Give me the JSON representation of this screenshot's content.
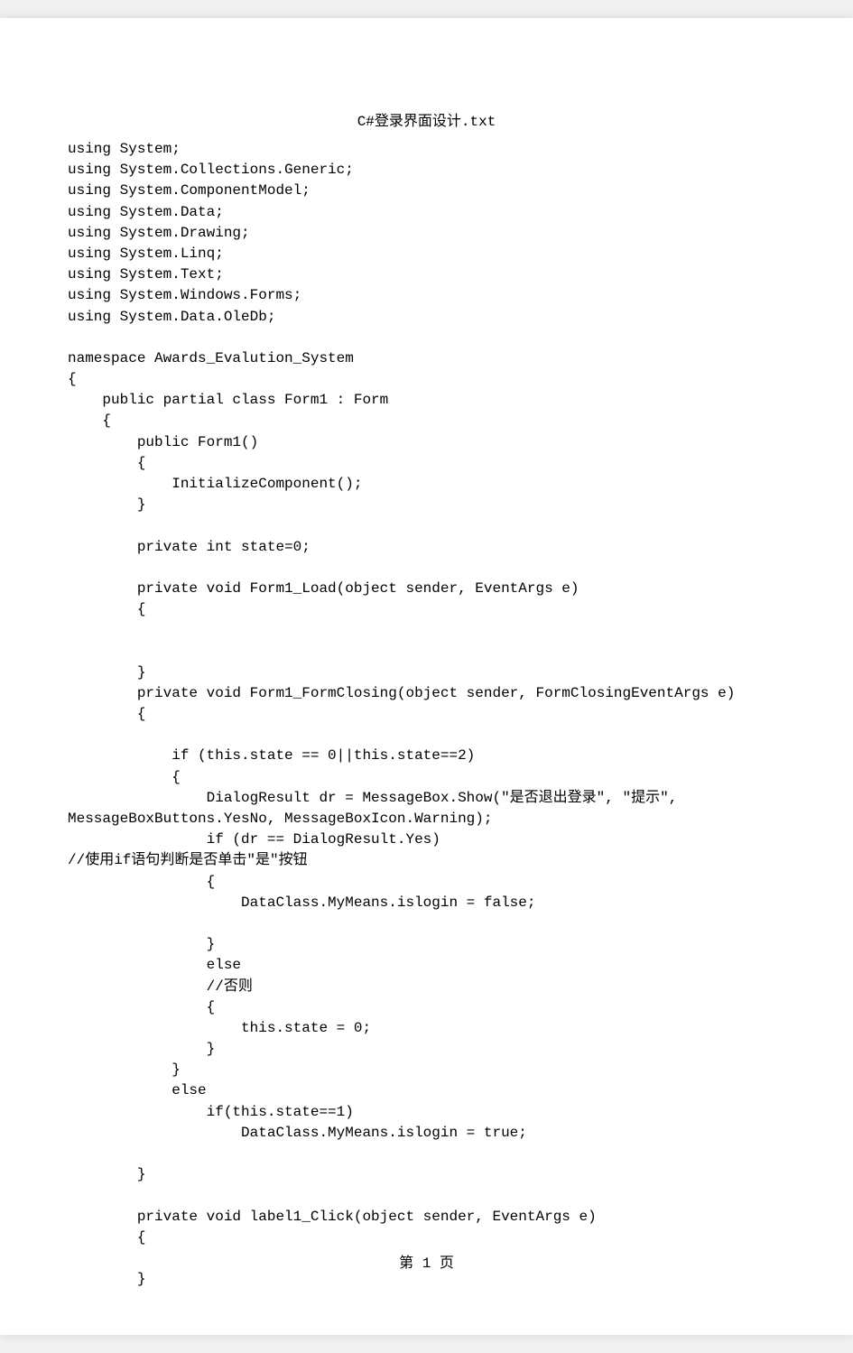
{
  "document": {
    "title": "C#登录界面设计.txt",
    "page_number": "第 1 页",
    "code": "using System;\nusing System.Collections.Generic;\nusing System.ComponentModel;\nusing System.Data;\nusing System.Drawing;\nusing System.Linq;\nusing System.Text;\nusing System.Windows.Forms;\nusing System.Data.OleDb;\n\nnamespace Awards_Evalution_System\n{\n    public partial class Form1 : Form\n    {\n        public Form1()\n        {\n            InitializeComponent();\n        }\n\n        private int state=0;\n\n        private void Form1_Load(object sender, EventArgs e)\n        {\n\n\n        }\n        private void Form1_FormClosing(object sender, FormClosingEventArgs e)\n        {\n\n            if (this.state == 0||this.state==2)\n            {\n                DialogResult dr = MessageBox.Show(\"是否退出登录\", \"提示\", \nMessageBoxButtons.YesNo, MessageBoxIcon.Warning);\n                if (dr == DialogResult.Yes)                                                               \n//使用if语句判断是否单击\"是\"按钮\n                {\n                    DataClass.MyMeans.islogin = false;\n\n                }\n                else                                                                                     \n                //否则\n                {\n                    this.state = 0;\n                }\n            }\n            else\n                if(this.state==1)\n                    DataClass.MyMeans.islogin = true;\n\n        }\n\n        private void label1_Click(object sender, EventArgs e)\n        {\n\n        }"
  }
}
